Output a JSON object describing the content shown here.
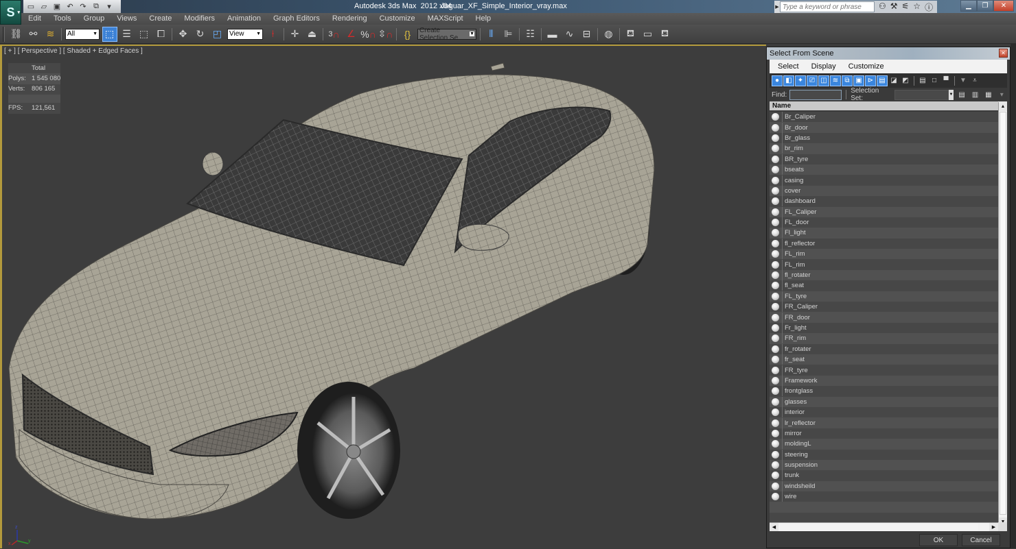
{
  "window": {
    "app_title": "Autodesk 3ds Max  2012 x64",
    "file_name": "Jaguar_XF_Simple_Interior_vray.max",
    "search_placeholder": "Type a keyword or phrase",
    "controls": {
      "minimize": "▁",
      "restore": "❐",
      "close": "✕"
    }
  },
  "quick_access": [
    {
      "name": "new-file-icon",
      "glyph": "🗋"
    },
    {
      "name": "open-file-icon",
      "glyph": "📂"
    },
    {
      "name": "save-icon",
      "glyph": "💾"
    },
    {
      "name": "undo-icon",
      "glyph": "↶"
    },
    {
      "name": "redo-icon",
      "glyph": "↷"
    },
    {
      "name": "project-folder-icon",
      "glyph": "🗐"
    },
    {
      "name": "customize-qat-icon",
      "glyph": "▾"
    }
  ],
  "search_icons": [
    {
      "name": "binoculars-icon",
      "glyph": "⚲"
    },
    {
      "name": "wrench-icon",
      "glyph": "🔧"
    },
    {
      "name": "satellite-icon",
      "glyph": "📡"
    },
    {
      "name": "star-icon",
      "glyph": "☆"
    },
    {
      "name": "help-icon",
      "glyph": "?"
    }
  ],
  "menu": [
    "Edit",
    "Tools",
    "Group",
    "Views",
    "Create",
    "Modifiers",
    "Animation",
    "Graph Editors",
    "Rendering",
    "Customize",
    "MAXScript",
    "Help"
  ],
  "toolbar": {
    "selection_filter": "All",
    "reference_coord": "View",
    "named_selection": "Create Selection Se",
    "snap_label": "3"
  },
  "viewport": {
    "label": "[ + ] [ Perspective ] [ Shaded + Edged Faces ]",
    "stats": {
      "header": "Total",
      "polys_label": "Polys:",
      "polys": "1 545 080",
      "verts_label": "Verts:",
      "verts": "806 165",
      "fps_label": "FPS:",
      "fps": "121,561"
    },
    "axis": {
      "x": "x",
      "y": "y",
      "z": "z"
    },
    "border_color": "#b39a3c"
  },
  "dialog": {
    "title": "Select From Scene",
    "menu": [
      "Select",
      "Display",
      "Customize"
    ],
    "find_label": "Find:",
    "find_value": "",
    "selection_set_label": "Selection Set:",
    "selection_set_value": "",
    "column_header": "Name",
    "objects": [
      "Br_Caliper",
      "Br_door",
      "Br_glass",
      "br_rim",
      "BR_tyre",
      "bseats",
      "casing",
      "cover",
      "dashboard",
      "FL_Caliper",
      "FL_door",
      "Fl_light",
      "fl_reflector",
      "FL_rim",
      "FL_rim",
      "fl_rotater",
      "fl_seat",
      "FL_tyre",
      "FR_Caliper",
      "FR_door",
      "Fr_light",
      "FR_rim",
      "fr_rotater",
      "fr_seat",
      "FR_tyre",
      "Framework",
      "frontglass",
      "glasses",
      "interior",
      "lr_reflector",
      "mirror",
      "moldingL",
      "steering",
      "suspension",
      "trunk",
      "windsheild",
      "wire"
    ],
    "ok_label": "OK",
    "cancel_label": "Cancel"
  }
}
